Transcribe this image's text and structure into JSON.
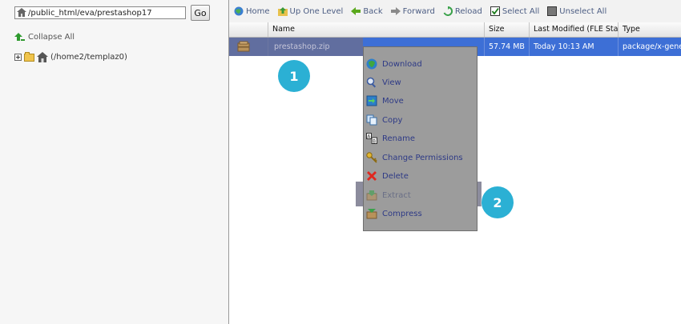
{
  "left": {
    "path_value": "/public_html/eva/prestashop17",
    "go_label": "Go",
    "collapse_all_label": "Collapse All",
    "tree_root_label": "(/home2/templaz0)"
  },
  "toolbar": {
    "home": "Home",
    "up_one_level": "Up One Level",
    "back": "Back",
    "forward": "Forward",
    "reload": "Reload",
    "select_all": "Select All",
    "unselect_all": "Unselect All"
  },
  "table": {
    "headers": [
      "Name",
      "Size",
      "Last Modified (FLE Stand",
      "Type"
    ],
    "rows": [
      {
        "name": "prestashop.zip",
        "size": "57.74 MB",
        "modified": "Today 10:13 AM",
        "type": "package/x-generic"
      }
    ]
  },
  "context_menu": {
    "items": [
      {
        "label": "Download",
        "icon": "download-icon"
      },
      {
        "label": "View",
        "icon": "magnifier-icon"
      },
      {
        "label": "Move",
        "icon": "move-icon"
      },
      {
        "label": "Copy",
        "icon": "copy-icon"
      },
      {
        "label": "Rename",
        "icon": "rename-icon"
      },
      {
        "label": "Change Permissions",
        "icon": "key-icon"
      },
      {
        "label": "Delete",
        "icon": "delete-x-icon"
      },
      {
        "label": "Extract",
        "icon": "extract-icon"
      },
      {
        "label": "Compress",
        "icon": "compress-icon"
      }
    ]
  },
  "badges": {
    "step1": "1",
    "step2": "2"
  },
  "colors": {
    "selected_row": "#3d6fd6",
    "badge": "#2bb0d4",
    "menu_bg": "#9c9c9c",
    "menu_text": "#2e3a86"
  }
}
